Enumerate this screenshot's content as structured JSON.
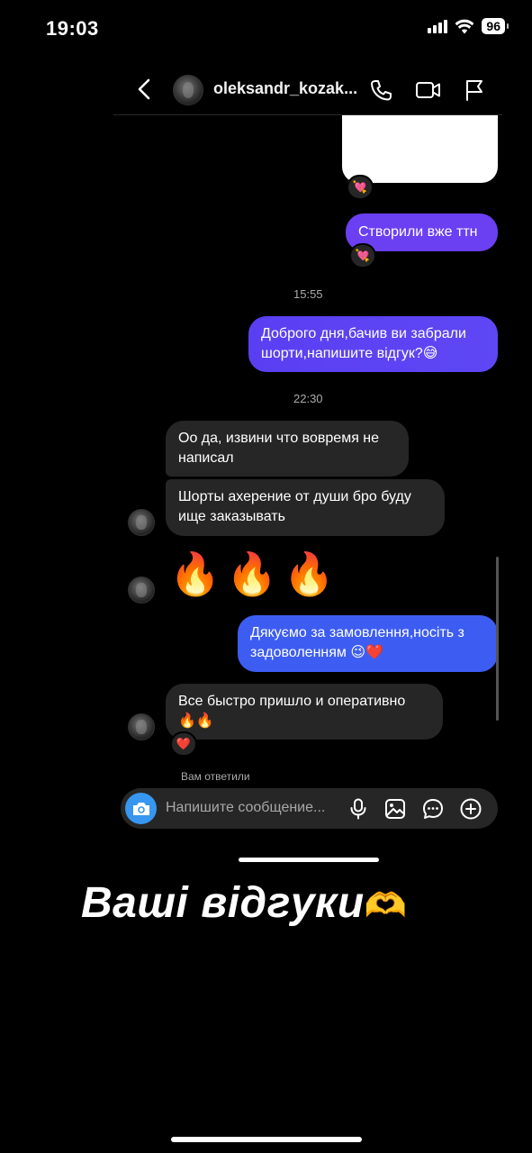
{
  "status_bar": {
    "time": "19:03",
    "battery": "96"
  },
  "header": {
    "username": "oleksandr_kozak...",
    "icons": [
      "back-chevron-icon",
      "phone-icon",
      "video-icon",
      "flag-icon"
    ]
  },
  "messages": {
    "sent_1_reaction": "💘",
    "sent_2": "Створили вже ттн",
    "sent_2_reaction": "💘",
    "time_1": "15:55",
    "sent_3_line1": "Доброго дня,бачив ви забрали",
    "sent_3_line2": "шорти,напишите відгук?😅",
    "time_2": "22:30",
    "recv_1_line1": "Оо да, извини что вовремя не",
    "recv_1_line2": "написал",
    "recv_2_line1": "Шорты ахерение от души бро буду",
    "recv_2_line2": "ище заказывать",
    "recv_3": "🔥🔥🔥",
    "sent_4_line1": "Дякуємо за замовлення,носіть з",
    "sent_4_line2": "задоволенням 😉❤️",
    "recv_4_line1": "Все быстро пришло  и оперативно",
    "recv_4_line2": "🔥🔥",
    "recv_4_reaction": "❤️",
    "replied_note": "Вам ответили"
  },
  "composer": {
    "placeholder": "Напишите сообщение...",
    "icons": [
      "camera-icon",
      "microphone-icon",
      "gallery-icon",
      "sticker-icon",
      "plus-icon"
    ]
  },
  "caption": {
    "text": "Ваші відгуки",
    "emoji": "🫶"
  },
  "colors": {
    "sent_purple": "#6b3ff2",
    "sent_blue": "#3d5df2",
    "received_grey": "#262626",
    "accent_blue": "#3797f0"
  }
}
